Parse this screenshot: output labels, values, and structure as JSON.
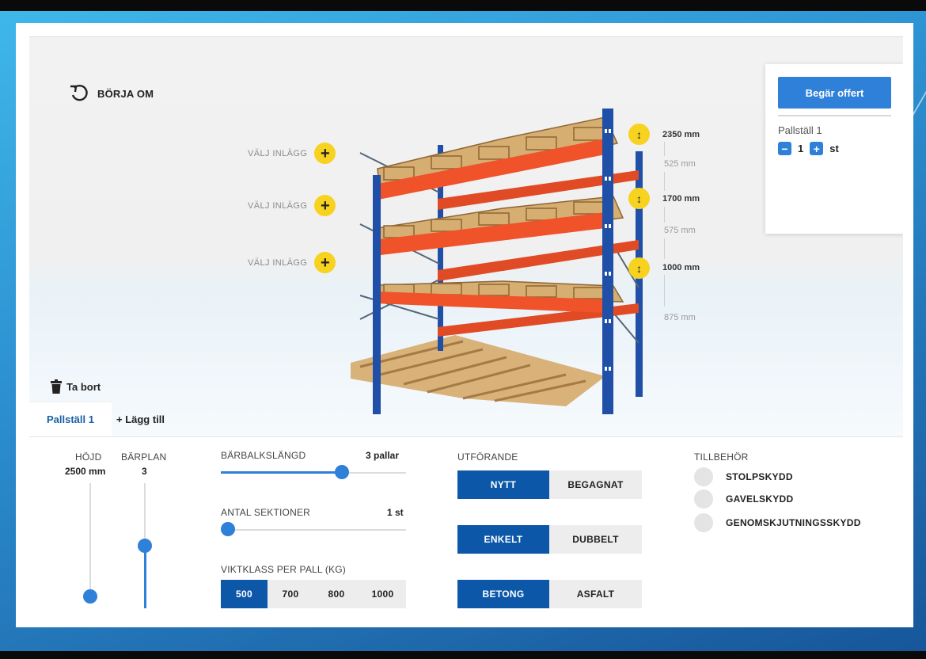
{
  "toolbar": {
    "restart_label": "BÖRJA OM"
  },
  "shelves": [
    {
      "label": "VÄLJ INLÄGG"
    },
    {
      "label": "VÄLJ INLÄGG"
    },
    {
      "label": "VÄLJ INLÄGG"
    }
  ],
  "dimensions": {
    "levels": [
      "2350 mm",
      "1700 mm",
      "1000 mm"
    ],
    "gaps": [
      "525 mm",
      "575 mm",
      "875 mm"
    ]
  },
  "quote": {
    "button_label": "Begär offert",
    "item_name": "Pallställ 1",
    "quantity": "1",
    "unit": "st"
  },
  "actions": {
    "delete_label": "Ta bort"
  },
  "tabs": {
    "active_label": "Pallställ 1",
    "add_label": "+ Lägg till"
  },
  "controls": {
    "height": {
      "label": "HÖJD",
      "value": "2500 mm"
    },
    "levels": {
      "label": "BÄRPLAN",
      "value": "3"
    },
    "beam_length": {
      "label": "BÄRBALKSLÄNGD",
      "value": "3 pallar"
    },
    "sections": {
      "label": "ANTAL SEKTIONER",
      "value": "1 st"
    },
    "weight_class": {
      "label": "VIKTKLASS PER PALL (KG)",
      "options": [
        "500",
        "700",
        "800",
        "1000"
      ],
      "selected": "500"
    },
    "execution": {
      "label": "UTFÖRANDE",
      "condition": [
        "NYTT",
        "BEGAGNAT"
      ],
      "type": [
        "ENKELT",
        "DUBBELT"
      ],
      "floor": [
        "BETONG",
        "ASFALT"
      ]
    },
    "accessories": {
      "label": "TILLBEHÖR",
      "items": [
        "STOLPSKYDD",
        "GAVELSKYDD",
        "GENOMSKJUTNINGSSKYDD"
      ]
    }
  },
  "colors": {
    "accent": "#0d57a8",
    "button": "#2f80d8",
    "marker": "#f7d21f",
    "beam": "#f0522a",
    "upright": "#1f4fa6"
  }
}
